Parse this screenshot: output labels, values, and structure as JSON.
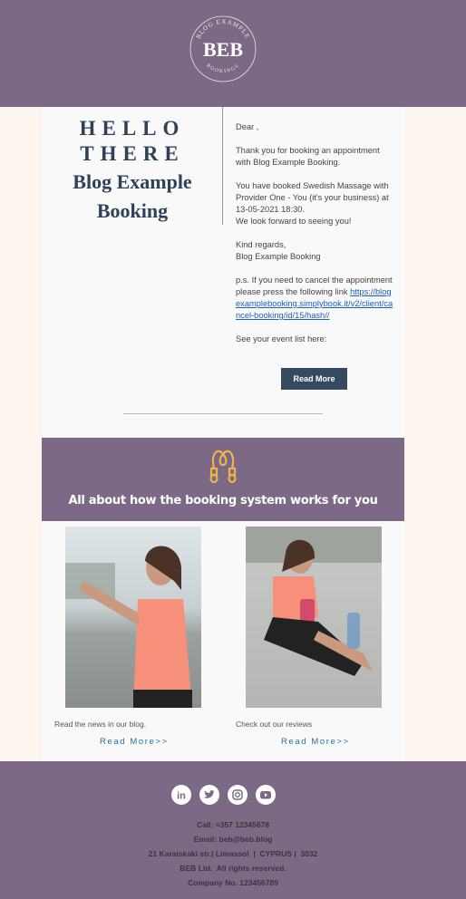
{
  "header": {
    "logo_text": "BEB",
    "logo_top": "BLOG EXAMPLE",
    "logo_bottom": "BOOKINGS"
  },
  "hero": {
    "line1": "HELLO",
    "line2": "THERE",
    "line3": "Blog Example",
    "line4": "Booking"
  },
  "letter": {
    "greeting": "Dear ,",
    "p1": "Thank you for booking an appointment with Blog Example Booking.",
    "p2a": "You have booked Swedish Massage with Provider One - You (it's your business) at 13-05-2021 18:30.",
    "p2b": "We look forward to seeing you!",
    "p3a": "Kind regards,",
    "p3b": "Blog Example Booking",
    "p4": "p.s. If you need to cancel the appointment please press the following link ",
    "link": "https://blogexamplebooking.simplybook.it/v2/client/cancel-booking/id/15/hash//",
    "p5": "See your event list here:",
    "button": "Read More"
  },
  "banner": {
    "title": "All about how the booking system works for you",
    "icon": "jump-rope-icon",
    "icon_color": "#f0b24a"
  },
  "cards": [
    {
      "caption": "Read the news in our blog.",
      "link": "Read More>>"
    },
    {
      "caption": "Check out our reviews",
      "link": "Read More>>"
    }
  ],
  "footer": {
    "social": [
      "linkedin-icon",
      "twitter-icon",
      "instagram-icon",
      "youtube-icon"
    ],
    "call": "Call: =357 12345678",
    "email": "Email: beb@beb.blog",
    "address": "21 Karaiskaki str.| Limassol  |  CYPRUS |  3032",
    "rights": "BEB Ltd.  All rights reserved.",
    "company": "Company No. 123456789"
  },
  "colors": {
    "brand": "#7b6985",
    "button": "#334a60",
    "heading": "#2f4158",
    "link": "#2a6fa8"
  }
}
